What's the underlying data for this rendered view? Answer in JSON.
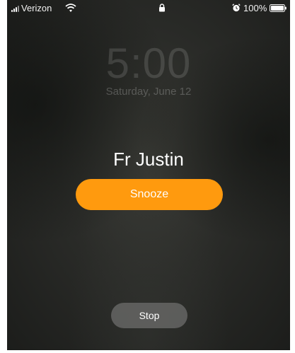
{
  "status_bar": {
    "carrier": "Verizon",
    "battery_percent": "100%",
    "icons": [
      "signal-icon",
      "wifi-icon",
      "lock-icon",
      "alarm-icon",
      "battery-icon"
    ]
  },
  "clock": {
    "time": "5:00",
    "date": "Saturday, June 12"
  },
  "alarm": {
    "label": "Fr Justin",
    "snooze_label": "Snooze",
    "stop_label": "Stop"
  },
  "colors": {
    "snooze_accent": "#ff9a0e",
    "background": "#2a2b28"
  }
}
